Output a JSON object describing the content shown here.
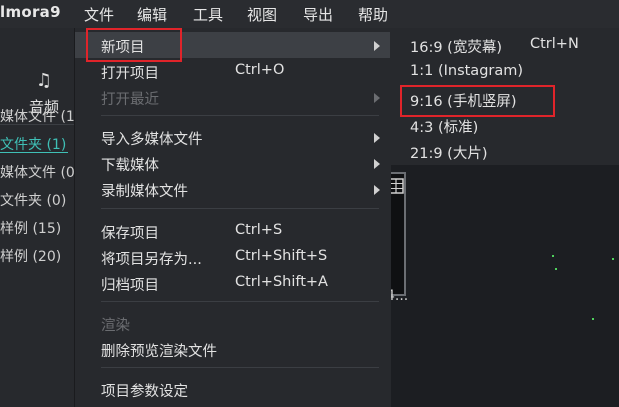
{
  "app": {
    "logo": "lmora9"
  },
  "menubar": {
    "file": "文件",
    "edit": "编辑",
    "tools": "工具",
    "view": "视图",
    "export": "导出",
    "help": "帮助"
  },
  "left_panel": {
    "audio_tab": "音频",
    "items": [
      "媒体文件 (1",
      "文件夹 (1)",
      "媒体文件 (0",
      "文件夹 (0)",
      "样例 (15)",
      "样例 (20)"
    ]
  },
  "file_menu": {
    "new_project": "新项目",
    "open_project": "打开项目",
    "open_project_shortcut": "Ctrl+O",
    "open_recent": "打开最近",
    "import_media": "导入多媒体文件",
    "download_media": "下载媒体",
    "record_media": "录制媒体文件",
    "save_project": "保存项目",
    "save_project_shortcut": "Ctrl+S",
    "save_as": "将项目另存为...",
    "save_as_shortcut": "Ctrl+Shift+S",
    "archive": "归档项目",
    "archive_shortcut": "Ctrl+Shift+A",
    "render": "渲染",
    "delete_preview": "删除预览渲染文件",
    "project_settings": "项目参数设定"
  },
  "new_project_submenu": {
    "r16_9": "16:9 (宽荧幕)",
    "r16_9_shortcut": "Ctrl+N",
    "r1_1": "1:1 (Instagram)",
    "r9_16": "9:16 (手机竖屏)",
    "r4_3": "4:3 (标准)",
    "r21_9": "21:9 (大片)"
  },
  "workspace": {
    "thumb_caption": "4..."
  },
  "colors": {
    "highlight": "#e0242a",
    "accent": "#3fc0b6",
    "hover": "#3d4045"
  }
}
